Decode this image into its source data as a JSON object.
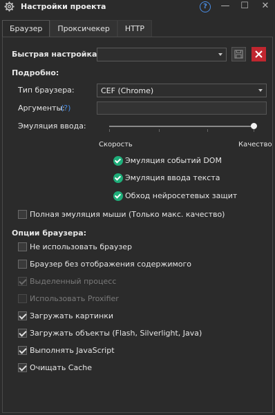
{
  "window": {
    "title": "Настройки проекта",
    "help": "?",
    "minimize": "—",
    "maximize": "☐",
    "close": "✕"
  },
  "tabs": [
    {
      "label": "Браузер",
      "active": true
    },
    {
      "label": "Проксичекер",
      "active": false
    },
    {
      "label": "HTTP",
      "active": false
    }
  ],
  "quick": {
    "label": "Быстрая настройка:",
    "value": ""
  },
  "details": {
    "heading": "Подробно:",
    "browser_type_label": "Тип браузера:",
    "browser_type_value": "CEF (Chrome)",
    "args_label": "Аргументы:",
    "args_help": "(?)",
    "args_value": "",
    "emulation_label": "Эмуляция ввода:",
    "slider_level": 1.0,
    "speed_label": "Скорость",
    "quality_label": "Качество",
    "features": [
      "Эмуляция событий DOM",
      "Эмуляция ввода текста",
      "Обход нейросетевых защит"
    ],
    "full_mouse": {
      "label": "Полная эмуляция мыши (Только макс. качество)",
      "checked": false
    }
  },
  "browser_options": {
    "heading": "Опции браузера:",
    "items": [
      {
        "label": "Не использовать браузер",
        "checked": false,
        "disabled": false
      },
      {
        "label": "Браузер без отображения содержимого",
        "checked": false,
        "disabled": false
      },
      {
        "label": "Выделенный процесс",
        "checked": true,
        "disabled": true
      },
      {
        "label": "Использовать Proxifier",
        "checked": false,
        "disabled": true
      },
      {
        "label": "Загружать картинки",
        "checked": true,
        "disabled": false
      },
      {
        "label": "Загружать объекты (Flash, Silverlight, Java)",
        "checked": true,
        "disabled": false
      },
      {
        "label": "Выполнять JavaScript",
        "checked": true,
        "disabled": false
      },
      {
        "label": "Очищать Cache",
        "checked": true,
        "disabled": false
      }
    ]
  },
  "colors": {
    "accent_green": "#1fae7a",
    "delete_red": "#c0262f",
    "help_blue": "#4a8ee6"
  }
}
